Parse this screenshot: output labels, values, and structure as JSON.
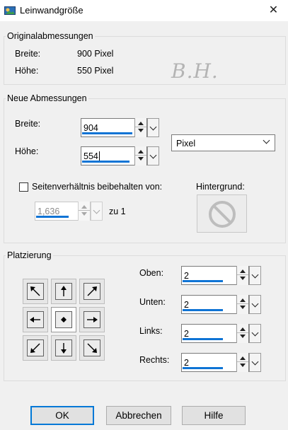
{
  "window": {
    "title": "Leinwandgröße",
    "close_symbol": "✕"
  },
  "original": {
    "legend": "Originalabmessungen",
    "width_label": "Breite:",
    "width_value": "900 Pixel",
    "height_label": "Höhe:",
    "height_value": "550 Pixel"
  },
  "watermark": "B.H.",
  "new_dims": {
    "legend": "Neue Abmessungen",
    "width_label": "Breite:",
    "width_value": "904",
    "height_label": "Höhe:",
    "height_value": "554",
    "unit_value": "Pixel",
    "keep_ratio_label": "Seitenverhältnis beibehalten von:",
    "keep_ratio_checked": false,
    "ratio_value": "1,636",
    "ratio_suffix": "zu 1",
    "background_label": "Hintergrund:",
    "background_icon": "no-color-icon"
  },
  "placement": {
    "legend": "Platzierung",
    "selected_anchor": "center",
    "top_label": "Oben:",
    "top_value": "2",
    "bottom_label": "Unten:",
    "bottom_value": "2",
    "left_label": "Links:",
    "left_value": "2",
    "right_label": "Rechts:",
    "right_value": "2"
  },
  "buttons": {
    "ok": "OK",
    "cancel": "Abbrechen",
    "help": "Hilfe"
  },
  "colors": {
    "accent": "#0078d7",
    "progress": "#0f74d5",
    "dialog_bg": "#f0f0f0"
  }
}
